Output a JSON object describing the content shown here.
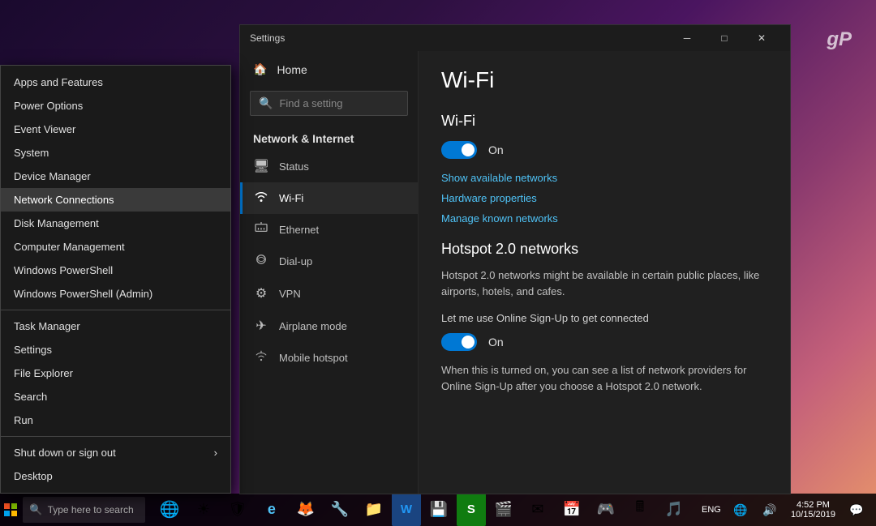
{
  "desktop": {
    "gp_logo": "gP"
  },
  "context_menu": {
    "items": [
      {
        "label": "Apps and Features",
        "id": "apps-features",
        "divider_after": false
      },
      {
        "label": "Power Options",
        "id": "power-options",
        "divider_after": false
      },
      {
        "label": "Event Viewer",
        "id": "event-viewer",
        "divider_after": false
      },
      {
        "label": "System",
        "id": "system",
        "divider_after": false
      },
      {
        "label": "Device Manager",
        "id": "device-manager",
        "divider_after": false
      },
      {
        "label": "Network Connections",
        "id": "network-connections",
        "highlighted": true,
        "divider_after": false
      },
      {
        "label": "Disk Management",
        "id": "disk-management",
        "divider_after": false
      },
      {
        "label": "Computer Management",
        "id": "computer-management",
        "divider_after": false
      },
      {
        "label": "Windows PowerShell",
        "id": "powershell",
        "divider_after": false
      },
      {
        "label": "Windows PowerShell (Admin)",
        "id": "powershell-admin",
        "divider_after": true
      },
      {
        "label": "Task Manager",
        "id": "task-manager",
        "divider_after": false
      },
      {
        "label": "Settings",
        "id": "settings",
        "divider_after": false
      },
      {
        "label": "File Explorer",
        "id": "file-explorer",
        "divider_after": false
      },
      {
        "label": "Search",
        "id": "search",
        "divider_after": false
      },
      {
        "label": "Run",
        "id": "run",
        "divider_after": true
      },
      {
        "label": "Shut down or sign out",
        "id": "shutdown",
        "has_arrow": true,
        "divider_after": false
      },
      {
        "label": "Desktop",
        "id": "desktop",
        "divider_after": false
      }
    ]
  },
  "settings_window": {
    "title": "Settings",
    "nav": {
      "home_label": "Home",
      "search_placeholder": "Find a setting",
      "section_title": "Network & Internet",
      "items": [
        {
          "label": "Status",
          "icon": "🖥",
          "id": "status"
        },
        {
          "label": "Wi-Fi",
          "icon": "📶",
          "id": "wifi",
          "active": true
        },
        {
          "label": "Ethernet",
          "icon": "🔌",
          "id": "ethernet"
        },
        {
          "label": "Dial-up",
          "icon": "📞",
          "id": "dialup"
        },
        {
          "label": "VPN",
          "icon": "⚙",
          "id": "vpn"
        },
        {
          "label": "Airplane mode",
          "icon": "✈",
          "id": "airplane"
        },
        {
          "label": "Mobile hotspot",
          "icon": "📡",
          "id": "mobile-hotspot"
        }
      ]
    },
    "content": {
      "page_title": "Wi-Fi",
      "wifi_section": {
        "title": "Wi-Fi",
        "toggle_state": "on",
        "toggle_label": "On",
        "links": [
          "Show available networks",
          "Hardware properties",
          "Manage known networks"
        ]
      },
      "hotspot_section": {
        "title": "Hotspot 2.0 networks",
        "description": "Hotspot 2.0 networks might be available in certain public places, like airports, hotels, and cafes.",
        "toggle_label2": "Let me use Online Sign-Up to get connected",
        "toggle_state2": "on",
        "toggle_label2_short": "On",
        "info_text": "When this is turned on, you can see a list of network providers for Online Sign-Up after you choose a Hotspot 2.0 network."
      }
    }
  },
  "taskbar": {
    "start_icon": "⊞",
    "search_placeholder": "Type here to search",
    "apps": [
      "🌐",
      "☀",
      "🛡",
      "🌀",
      "🦊",
      "🔧",
      "📁",
      "W",
      "💾",
      "S",
      "🎬",
      "✉",
      "📅",
      "🎮",
      "🖩",
      "🎵"
    ],
    "time": "4:52 PM",
    "date": "10/15/2019"
  }
}
